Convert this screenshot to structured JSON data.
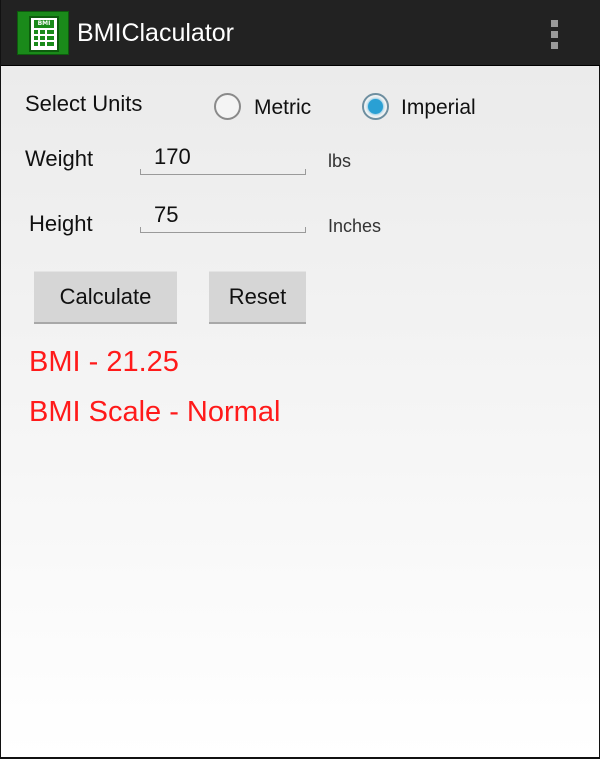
{
  "app": {
    "title": "BMIClaculator",
    "icon_text": "BMI",
    "accent_color": "#1a8a1a"
  },
  "units": {
    "label": "Select Units",
    "options": [
      {
        "label": "Metric",
        "selected": false
      },
      {
        "label": "Imperial",
        "selected": true
      }
    ]
  },
  "weight": {
    "label": "Weight",
    "value": "170",
    "unit": "lbs"
  },
  "height": {
    "label": "Height",
    "value": "75",
    "unit": "Inches"
  },
  "buttons": {
    "calculate": "Calculate",
    "reset": "Reset"
  },
  "result": {
    "bmi": "BMI - 21.25",
    "scale": "BMI Scale - Normal",
    "color": "#ff1a1a"
  }
}
